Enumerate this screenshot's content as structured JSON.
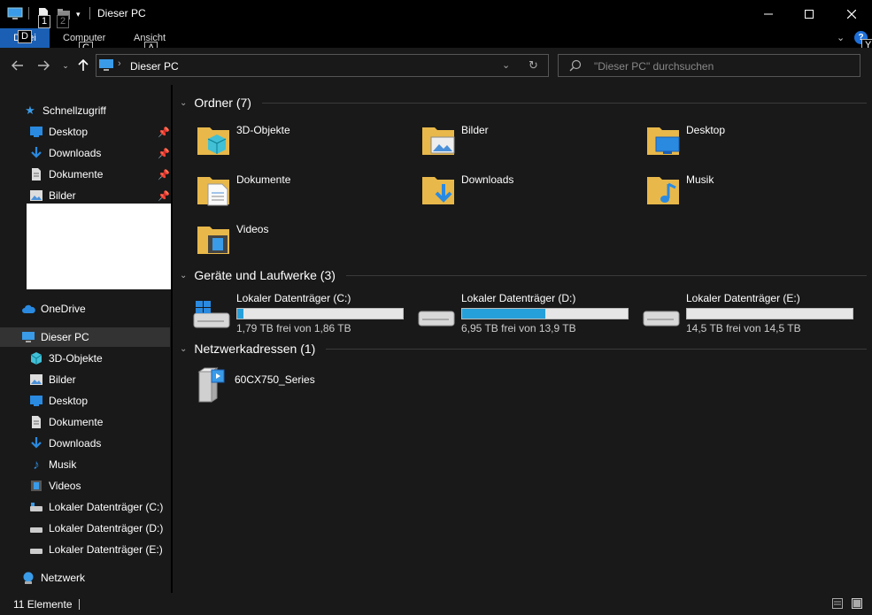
{
  "window": {
    "title": "Dieser PC"
  },
  "keytips": {
    "quick1": "1",
    "quick2": "2",
    "file": "D",
    "computer": "C",
    "view": "A",
    "help": "Y"
  },
  "ribbon": {
    "file_label": "Datei",
    "tabs": [
      "Computer",
      "Ansicht"
    ]
  },
  "address": {
    "path": "Dieser PC",
    "search_placeholder": "\"Dieser PC\" durchsuchen"
  },
  "sidebar": {
    "quick_access": "Schnellzugriff",
    "quick_items": [
      "Desktop",
      "Downloads",
      "Dokumente",
      "Bilder"
    ],
    "onedrive": "OneDrive",
    "this_pc": "Dieser PC",
    "pc_items": [
      "3D-Objekte",
      "Bilder",
      "Desktop",
      "Dokumente",
      "Downloads",
      "Musik",
      "Videos",
      "Lokaler Datenträger (C:)",
      "Lokaler Datenträger (D:)",
      "Lokaler Datenträger (E:)"
    ],
    "network": "Netzwerk"
  },
  "groups": {
    "folders": "Ordner (7)",
    "drives": "Geräte und Laufwerke (3)",
    "network": "Netzwerkadressen (1)"
  },
  "folders": [
    "3D-Objekte",
    "Bilder",
    "Desktop",
    "Dokumente",
    "Downloads",
    "Musik",
    "Videos"
  ],
  "drives": [
    {
      "name": "Lokaler Datenträger (C:)",
      "free": "1,79 TB frei von 1,86 TB",
      "used_fraction": 0.04
    },
    {
      "name": "Lokaler Datenträger (D:)",
      "free": "6,95 TB frei von 13,9 TB",
      "used_fraction": 0.5
    },
    {
      "name": "Lokaler Datenträger (E:)",
      "free": "14,5 TB frei von 14,5 TB",
      "used_fraction": 0.0
    }
  ],
  "network_items": [
    "60CX750_Series"
  ],
  "status": {
    "count": "11 Elemente"
  },
  "colors": {
    "accent": "#1a5fb4",
    "bar_fill": "#26a0da",
    "folder": "#f4c95d",
    "bg": "#191919"
  }
}
